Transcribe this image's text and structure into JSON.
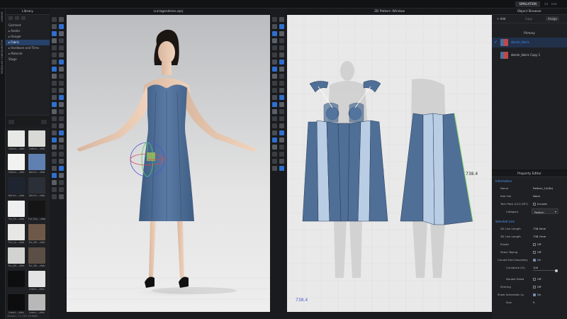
{
  "topbar": {
    "simulation_label": "SIMULATION",
    "cloud_icon": "cloud-icon",
    "exit_label": "EXIT"
  },
  "left_strip": {
    "tabs": [
      "LIBRARY",
      "MODULAR CONFIGURATOR"
    ]
  },
  "library": {
    "title": "Library",
    "tree": [
      {
        "label": "Garment",
        "selected": false
      },
      {
        "label": "▸ Avatar",
        "selected": false
      },
      {
        "label": "▸ Hanger",
        "selected": false
      },
      {
        "label": "▸ Fabric",
        "selected": true
      },
      {
        "label": "▸ Hardware and Trims",
        "selected": false
      },
      {
        "label": "▸ Material",
        "selected": false
      },
      {
        "label": "Stage",
        "selected": false
      }
    ],
    "thumbnails": [
      {
        "label": "Cotton....zfab",
        "color": "#e8e8e6"
      },
      {
        "label": "Cotton....zfab",
        "color": "#d9d9d6"
      },
      {
        "label": "Cotton....zfab",
        "color": "#f2f2f0"
      },
      {
        "label": "Denim....zfab",
        "color": "#5f80b0"
      },
      {
        "label": "Denim....zfab",
        "color": "#1f2530"
      },
      {
        "label": "Denim....zfab",
        "color": "#2a2f38"
      },
      {
        "label": "Fur_Fo....zfab",
        "color": "#efefef"
      },
      {
        "label": "Fur_Fox....zfab",
        "color": "#151515"
      },
      {
        "label": "Fur_Lo....zfab",
        "color": "#e7e7e5"
      },
      {
        "label": "Fur_Wi....zfab",
        "color": "#6e5948"
      },
      {
        "label": "Fur_Wi....zfab",
        "color": "#d2d2d0"
      },
      {
        "label": "Fur_Wi....zfab",
        "color": "#5b4e45"
      },
      {
        "label": "",
        "color": "#0e0e0e"
      },
      {
        "label": "Insert....zfab",
        "color": "#e3e3e3"
      },
      {
        "label": "Insert....zfab",
        "color": "#0d0d0d"
      },
      {
        "label": "Insert....zfab",
        "color": "#b8b8b8"
      }
    ],
    "version": "Version: 7.1.134 (r43666)"
  },
  "view3d": {
    "title": "curragendress.zprj"
  },
  "view2d": {
    "title": "2D Pattern Window",
    "measure_label": "738.4",
    "corner_label": "738.4"
  },
  "object_browser": {
    "title": "Object Browser",
    "add_label": "Add",
    "copy_label": "Copy",
    "assign_label": "Assign",
    "group_label": "Primary",
    "fabrics": [
      {
        "name": "denim_fabric",
        "active": true
      },
      {
        "name": "denim_fabric Copy 1",
        "active": false
      }
    ]
  },
  "property_editor": {
    "title": "Property Editor",
    "sections": {
      "information": "Information",
      "selected_line": "Selected Line"
    },
    "rows": {
      "name_k": "Name",
      "name_v": "Pattern_14(5b)",
      "item_no_k": "Item No",
      "item_no_v": "None",
      "tech_pack_k": "Tech Pack (CLO-SET)",
      "tech_pack_v": "Include",
      "category_k": "Category",
      "category_v": "Pattern",
      "line2d_k": "2D Line Length",
      "line2d_v": "738.4mm",
      "line3d_k": "3D Line Length",
      "line3d_v": "738.7mm",
      "elastic_k": "Elastic",
      "elastic_v": "Off",
      "seam_taping_k": "Seam Taping",
      "seam_taping_v": "Off",
      "curved_fold_k": "Curved Fold Geometry",
      "curved_fold_v": "On",
      "curvature_k": "Curvature (%)",
      "curvature_v": "100",
      "double_sided_k": "Double Sided",
      "double_sided_v": "Off",
      "shirring_k": "Shirring",
      "shirring_v": "Off",
      "schematic_k": "Show Schematic Lo",
      "schematic_v": "On",
      "size_k": "Size",
      "size_v": "5"
    }
  },
  "colors": {
    "accent": "#3a8ff0",
    "denim": "#4f6f96",
    "denim_dark": "#3d5a7f",
    "selection": "#26416a"
  }
}
